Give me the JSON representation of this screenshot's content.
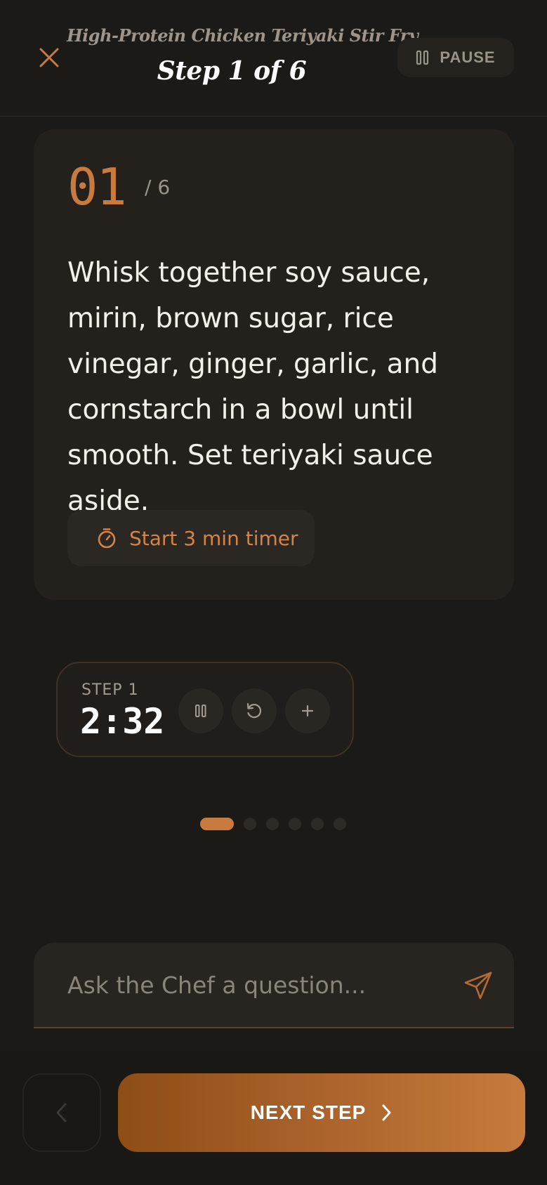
{
  "header": {
    "recipe_title": "High-Protein Chicken Teriyaki Stir Fry",
    "step_title": "Step 1 of 6",
    "pause_label": "PAUSE"
  },
  "step": {
    "number": "01",
    "total": "/ 6",
    "instruction": "Whisk together soy sauce, mirin, brown sugar, rice vinegar, ginger, garlic, and cornstarch in a bowl until smooth. Set teriyaki sauce aside.",
    "timer_button_label": "Start 3 min timer"
  },
  "timer": {
    "label": "STEP 1",
    "time": "2:32"
  },
  "progress": {
    "current_step": 1,
    "total_steps": 6
  },
  "ask": {
    "placeholder": "Ask the Chef a question..."
  },
  "footer": {
    "next_label": "NEXT STEP"
  },
  "colors": {
    "accent": "#c97a3e",
    "background": "#1c1a17",
    "card": "#24211d"
  },
  "icons": [
    "close-icon",
    "pause-icon",
    "stopwatch-icon",
    "reset-icon",
    "plus-icon",
    "send-icon",
    "chevron-left-icon",
    "chevron-right-icon"
  ]
}
